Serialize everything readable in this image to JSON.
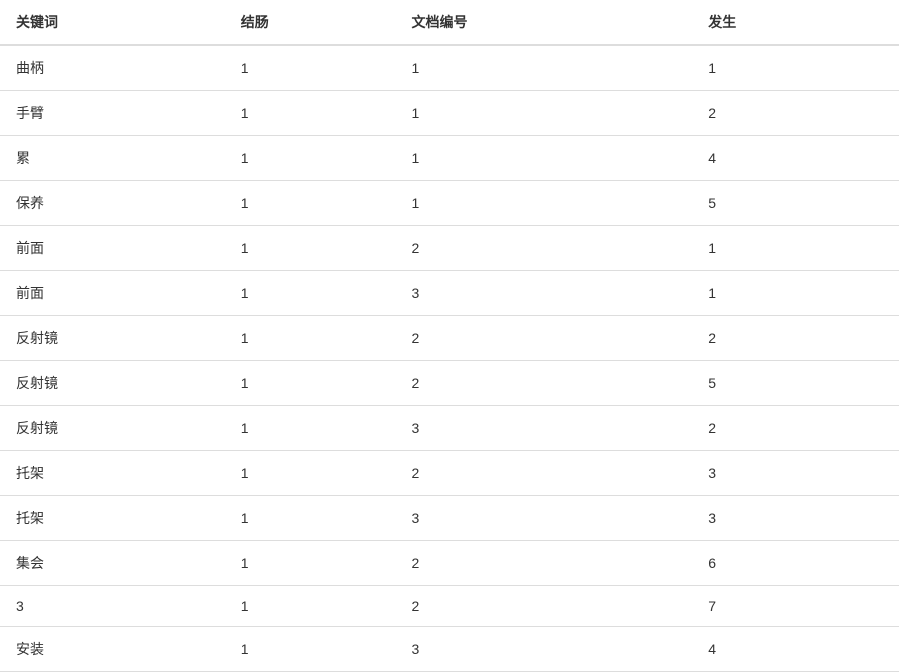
{
  "table": {
    "headers": {
      "keyword": "关键词",
      "colon": "结肠",
      "docnum": "文档编号",
      "occur": "发生"
    },
    "rows": [
      {
        "keyword": "曲柄",
        "colon": "1",
        "docnum": "1",
        "occur": "1"
      },
      {
        "keyword": "手臂",
        "colon": "1",
        "docnum": "1",
        "occur": "2"
      },
      {
        "keyword": "累",
        "colon": "1",
        "docnum": "1",
        "occur": "4"
      },
      {
        "keyword": "保养",
        "colon": "1",
        "docnum": "1",
        "occur": "5"
      },
      {
        "keyword": "前面",
        "colon": "1",
        "docnum": "2",
        "occur": "1"
      },
      {
        "keyword": "前面",
        "colon": "1",
        "docnum": "3",
        "occur": "1"
      },
      {
        "keyword": "反射镜",
        "colon": "1",
        "docnum": "2",
        "occur": "2"
      },
      {
        "keyword": "反射镜",
        "colon": "1",
        "docnum": "2",
        "occur": "5"
      },
      {
        "keyword": "反射镜",
        "colon": "1",
        "docnum": "3",
        "occur": "2"
      },
      {
        "keyword": "托架",
        "colon": "1",
        "docnum": "2",
        "occur": "3"
      },
      {
        "keyword": "托架",
        "colon": "1",
        "docnum": "3",
        "occur": "3"
      },
      {
        "keyword": "集会",
        "colon": "1",
        "docnum": "2",
        "occur": "6"
      },
      {
        "keyword": "3",
        "colon": "1",
        "docnum": "2",
        "occur": "7"
      },
      {
        "keyword": "安装",
        "colon": "1",
        "docnum": "3",
        "occur": "4"
      }
    ]
  }
}
